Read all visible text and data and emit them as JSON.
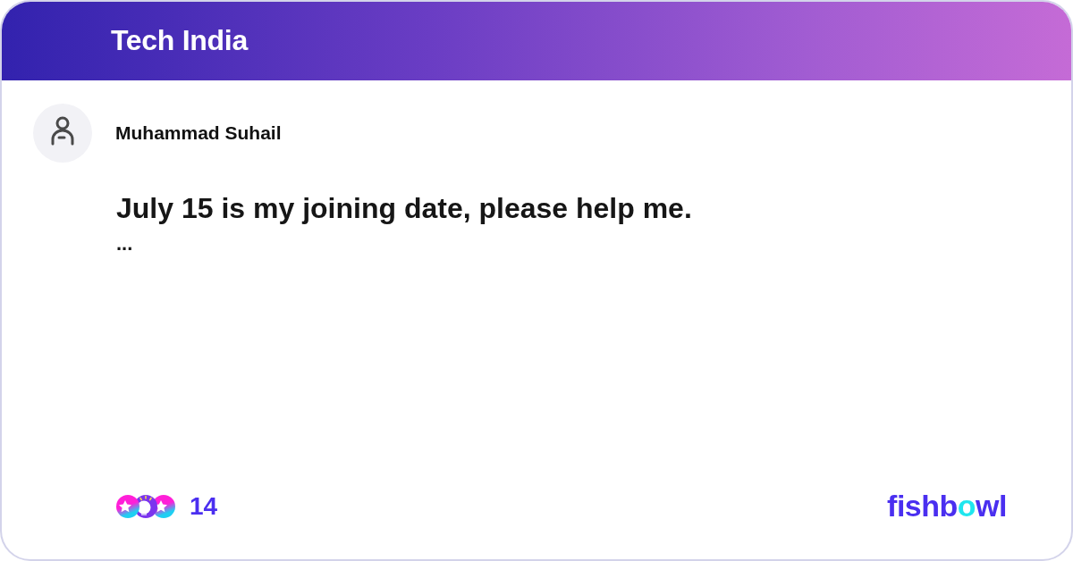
{
  "header": {
    "title": "Tech India"
  },
  "post": {
    "author": {
      "name": "Muhammad Suhail"
    },
    "text": "July 15 is my joining date, please help me.",
    "more": "..."
  },
  "footer": {
    "reactions": [
      {
        "kind": "star"
      },
      {
        "kind": "bulb"
      },
      {
        "kind": "star"
      }
    ],
    "reaction_count": "14",
    "logo": {
      "parts": [
        {
          "text": "fishb",
          "accent": false
        },
        {
          "text": "o",
          "accent": true
        },
        {
          "text": "wl",
          "accent": false
        }
      ]
    }
  }
}
